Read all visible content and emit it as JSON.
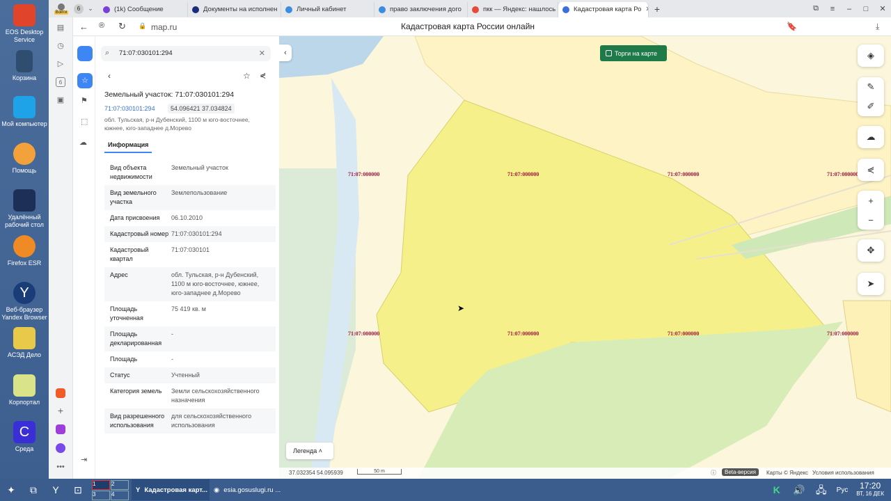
{
  "desktop": {
    "icons": [
      "EOS Desktop Service",
      "Корзина",
      "Мой компьютер",
      "Помощь",
      "Удалённый рабочий стол",
      "Firefox ESR",
      "Веб-браузер Yandex Browser",
      "АСЭД Дело",
      "Корпортал",
      "Среда"
    ]
  },
  "browser": {
    "tabs": [
      "(1k) Сообщение",
      "Документы на исполнен",
      "Личный кабинет",
      "право заключения дого",
      "пкк — Яндекс: нашлось",
      "Кадастровая карта Ро"
    ],
    "tab_count_badge": "6",
    "login_label": "Войти",
    "url": "map.ru",
    "page_title": "Кадастровая карта России онлайн"
  },
  "panel": {
    "search_value": "71:07:030101:294",
    "title": "Земельный участок: 71:07:030101:294",
    "cad_number": "71:07:030101:294",
    "coords": "54.096421 37.034824",
    "address_line": "обл. Тульская, р-н Дубенский, 1100 м юго-восточнее, южнее, юго-западнее д.Морево",
    "tab_info": "Информация",
    "rows": [
      {
        "k": "Вид объекта недвижимости",
        "v": "Земельный участок"
      },
      {
        "k": "Вид земельного участка",
        "v": "Землепользование"
      },
      {
        "k": "Дата присвоения",
        "v": "06.10.2010"
      },
      {
        "k": "Кадастровый номер",
        "v": "71:07:030101:294"
      },
      {
        "k": "Кадастровый квартал",
        "v": "71:07:030101"
      },
      {
        "k": "Адрес",
        "v": "обл. Тульская, р-н Дубенский, 1100 м юго-восточнее, южнее, юго-западнее д.Морево"
      },
      {
        "k": "Площадь уточненная",
        "v": "75 419 кв. м"
      },
      {
        "k": "Площадь декларированная",
        "v": "-"
      },
      {
        "k": "Площадь",
        "v": "-"
      },
      {
        "k": "Статус",
        "v": "Учтенный"
      },
      {
        "k": "Категория земель",
        "v": "Земли сельскохозяйственного назначения"
      },
      {
        "k": "Вид разрешенного использования",
        "v": "для сельскохозяйственного использования"
      }
    ]
  },
  "map": {
    "auction_toggle": "Торги на карте",
    "quarter_label": "71:07:000000",
    "legend": "Легенда",
    "cursor_coords": "37.032354  54.095939",
    "scale": "50 m",
    "beta": "Beta-версия",
    "attribution": "Карты © Яндекс",
    "terms": "Условия использования"
  },
  "taskbar": {
    "active_window": "Кадастровая карт...",
    "other_window": "esia.gosuslugi.ru ...",
    "workspaces": [
      "1",
      "2",
      "3",
      "4"
    ],
    "lang": "Рус",
    "time": "17:20",
    "date": "ВТ, 16 ДЕК"
  }
}
